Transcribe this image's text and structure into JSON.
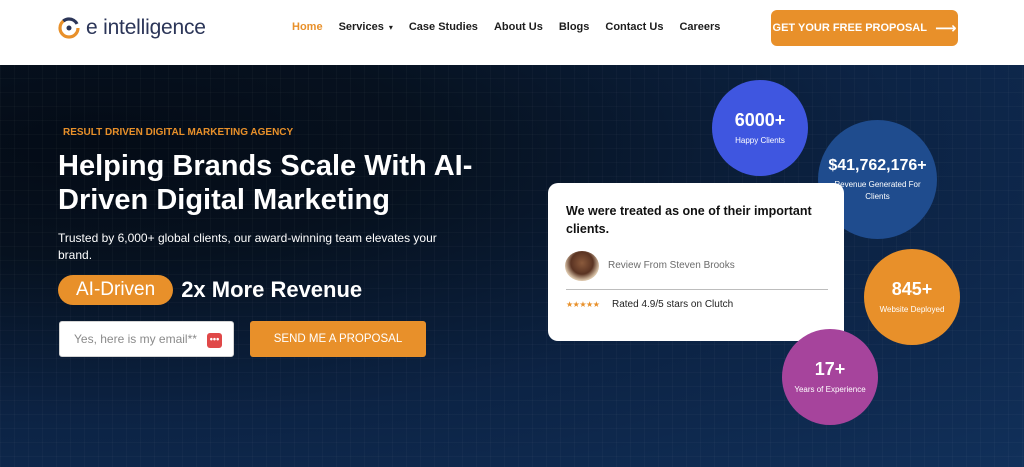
{
  "brand": {
    "name": "e intelligence"
  },
  "nav": {
    "items": [
      {
        "label": "Home",
        "active": true
      },
      {
        "label": "Services",
        "has_dropdown": true
      },
      {
        "label": "Case Studies"
      },
      {
        "label": "About Us"
      },
      {
        "label": "Blogs"
      },
      {
        "label": "Contact Us"
      },
      {
        "label": "Careers"
      }
    ],
    "caret": "▾"
  },
  "header_cta": {
    "label": "GET YOUR FREE PROPOSAL",
    "arrow": "⟶"
  },
  "hero": {
    "eyebrow": "RESULT DRIVEN DIGITAL MARKETING AGENCY",
    "headline": "Helping Brands Scale With AI-Driven Digital Marketing",
    "subtext": "Trusted by 6,000+ global clients, our award-winning team elevates your brand.",
    "pill": "AI-Driven",
    "tagline_rest": "2x More Revenue",
    "email_placeholder": "Yes, here is my email**",
    "autofill_glyph": "•••",
    "send_label": "SEND ME A PROPOSAL"
  },
  "review": {
    "quote": "We were treated as one of their important clients.",
    "reviewer": "Review From Steven Brooks",
    "stars": "★★★★★",
    "rating_text": "Rated 4.9/5 stars on Clutch"
  },
  "stats": {
    "clients": {
      "value": "6000+",
      "label": "Happy Clients"
    },
    "revenue": {
      "value": "$41,762,176+",
      "label": "Revenue Generated For Clients"
    },
    "websites": {
      "value": "845+",
      "label": "Website Deployed"
    },
    "years": {
      "value": "17+",
      "label": "Years of Experience"
    }
  },
  "colors": {
    "accent": "#e8902a",
    "hero_bg": "#0b1a33",
    "clients_circle": "#3f56e0",
    "revenue_circle": "#1f4c8e",
    "websites_circle": "#e8902a",
    "years_circle": "#a6449c"
  }
}
